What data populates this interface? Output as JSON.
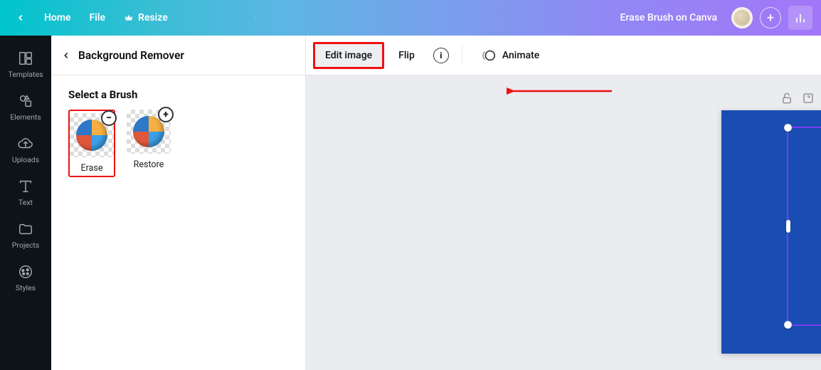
{
  "topbar": {
    "home": "Home",
    "file": "File",
    "resize": "Resize",
    "doc_title": "Erase Brush on Canva"
  },
  "rail": {
    "templates": "Templates",
    "elements": "Elements",
    "uploads": "Uploads",
    "text": "Text",
    "projects": "Projects",
    "styles": "Styles"
  },
  "side_panel": {
    "title": "Background Remover",
    "section": "Select a Brush",
    "erase": "Erase",
    "restore": "Restore"
  },
  "context_bar": {
    "edit_image": "Edit image",
    "flip": "Flip",
    "animate": "Animate",
    "help_glyph": "i"
  },
  "icons": {
    "minus": "−",
    "plus": "+",
    "more": "•••"
  }
}
